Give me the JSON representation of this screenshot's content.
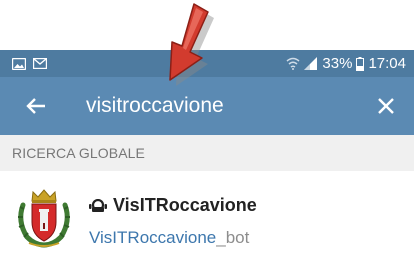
{
  "status_bar": {
    "left_icons": [
      "gallery-icon",
      "mail-icon"
    ],
    "right_icons": [
      "wifi-icon",
      "signal-icon",
      "battery-icon"
    ],
    "battery": "33%",
    "time": "17:04"
  },
  "search": {
    "query": "visitroccavione"
  },
  "section": {
    "header": "RICERCA GLOBALE"
  },
  "results": [
    {
      "name": "VisITRoccavione",
      "username_match": "VisITRoccavione",
      "username_rest": "_bot",
      "avatar_icon": "coat-of-arms-icon",
      "type_icon": "bot-icon"
    }
  ],
  "colors": {
    "status_bar": "#4e7ba0",
    "search_bar": "#5b8ab3",
    "section_bg": "#f0f0f0",
    "link_blue": "#3d77ad",
    "annotation_arrow": "#c0392b"
  }
}
